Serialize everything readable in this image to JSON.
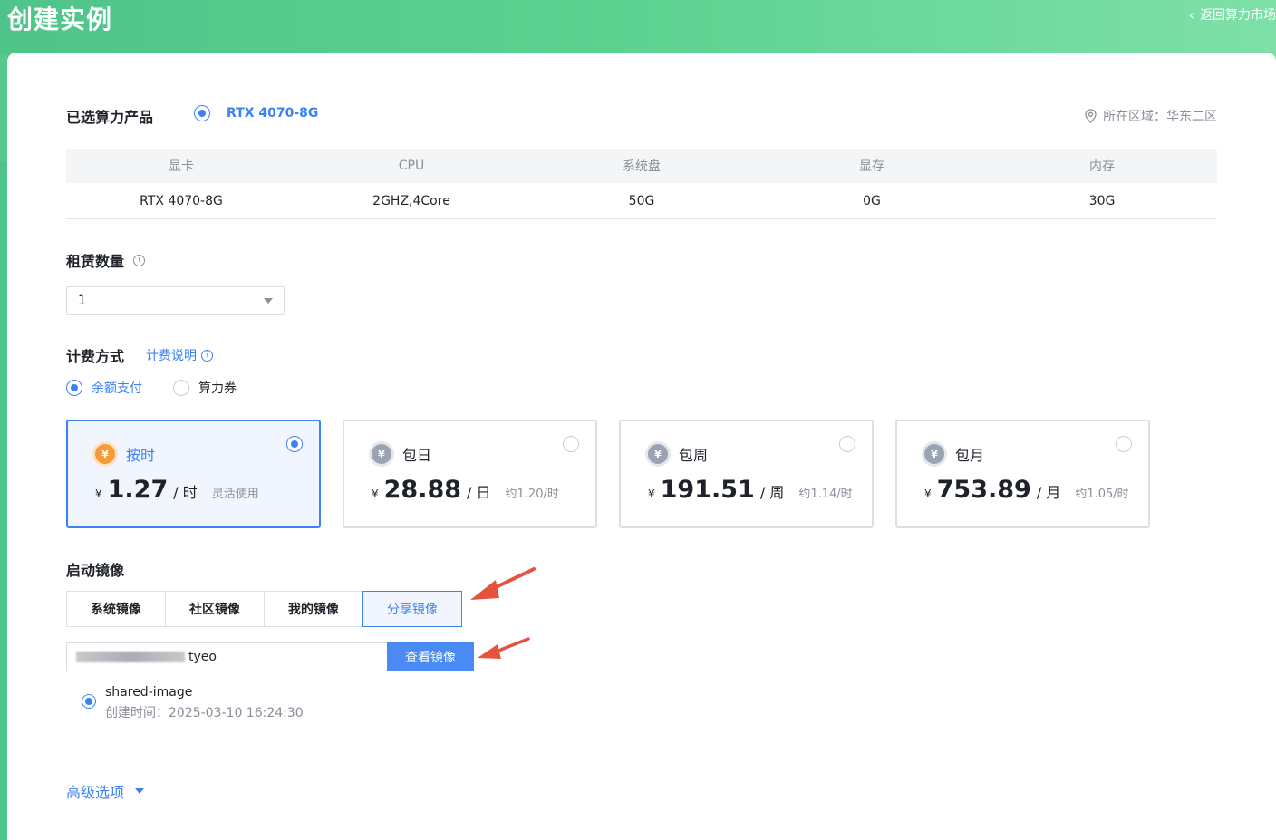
{
  "header": {
    "title": "创建实例",
    "back_label": "返回算力市场"
  },
  "product": {
    "section_label": "已选算力产品",
    "selected_name": "RTX 4070-8G",
    "region_label": "所在区域：华东二区"
  },
  "spec_table": {
    "headers": [
      "显卡",
      "CPU",
      "系统盘",
      "显存",
      "内存"
    ],
    "row": [
      "RTX 4070-8G",
      "2GHZ,4Core",
      "50G",
      "0G",
      "30G"
    ]
  },
  "quantity": {
    "label": "租赁数量",
    "info": "i",
    "value": "1"
  },
  "billing": {
    "label": "计费方式",
    "help_link": "计费说明",
    "help_icon": "?",
    "pay_options": [
      "余额支付",
      "算力券"
    ],
    "selected_pay": "余额支付",
    "plans": [
      {
        "name": "按时",
        "yen": "¥",
        "price": "1.27",
        "unit": "/ 时",
        "note": "灵活使用",
        "active": true,
        "icon": "¥"
      },
      {
        "name": "包日",
        "yen": "¥",
        "price": "28.88",
        "unit": "/ 日",
        "note": "约1.20/时",
        "active": false,
        "icon": "¥"
      },
      {
        "name": "包周",
        "yen": "¥",
        "price": "191.51",
        "unit": "/ 周",
        "note": "约1.14/时",
        "active": false,
        "icon": "¥"
      },
      {
        "name": "包月",
        "yen": "¥",
        "price": "753.89",
        "unit": "/ 月",
        "note": "约1.05/时",
        "active": false,
        "icon": "¥"
      }
    ]
  },
  "image": {
    "label": "启动镜像",
    "tabs": [
      "系统镜像",
      "社区镜像",
      "我的镜像",
      "分享镜像"
    ],
    "active_tab": "分享镜像",
    "search_value_suffix": "tyeo",
    "search_button": "查看镜像",
    "result": {
      "name": "shared-image",
      "created": "创建时间：2025-03-10 16:24:30"
    }
  },
  "advanced": {
    "label": "高级选项"
  },
  "colors": {
    "accent": "#3b82f6",
    "header_green": "#4fc48a",
    "annotation_red": "#e5533d"
  }
}
